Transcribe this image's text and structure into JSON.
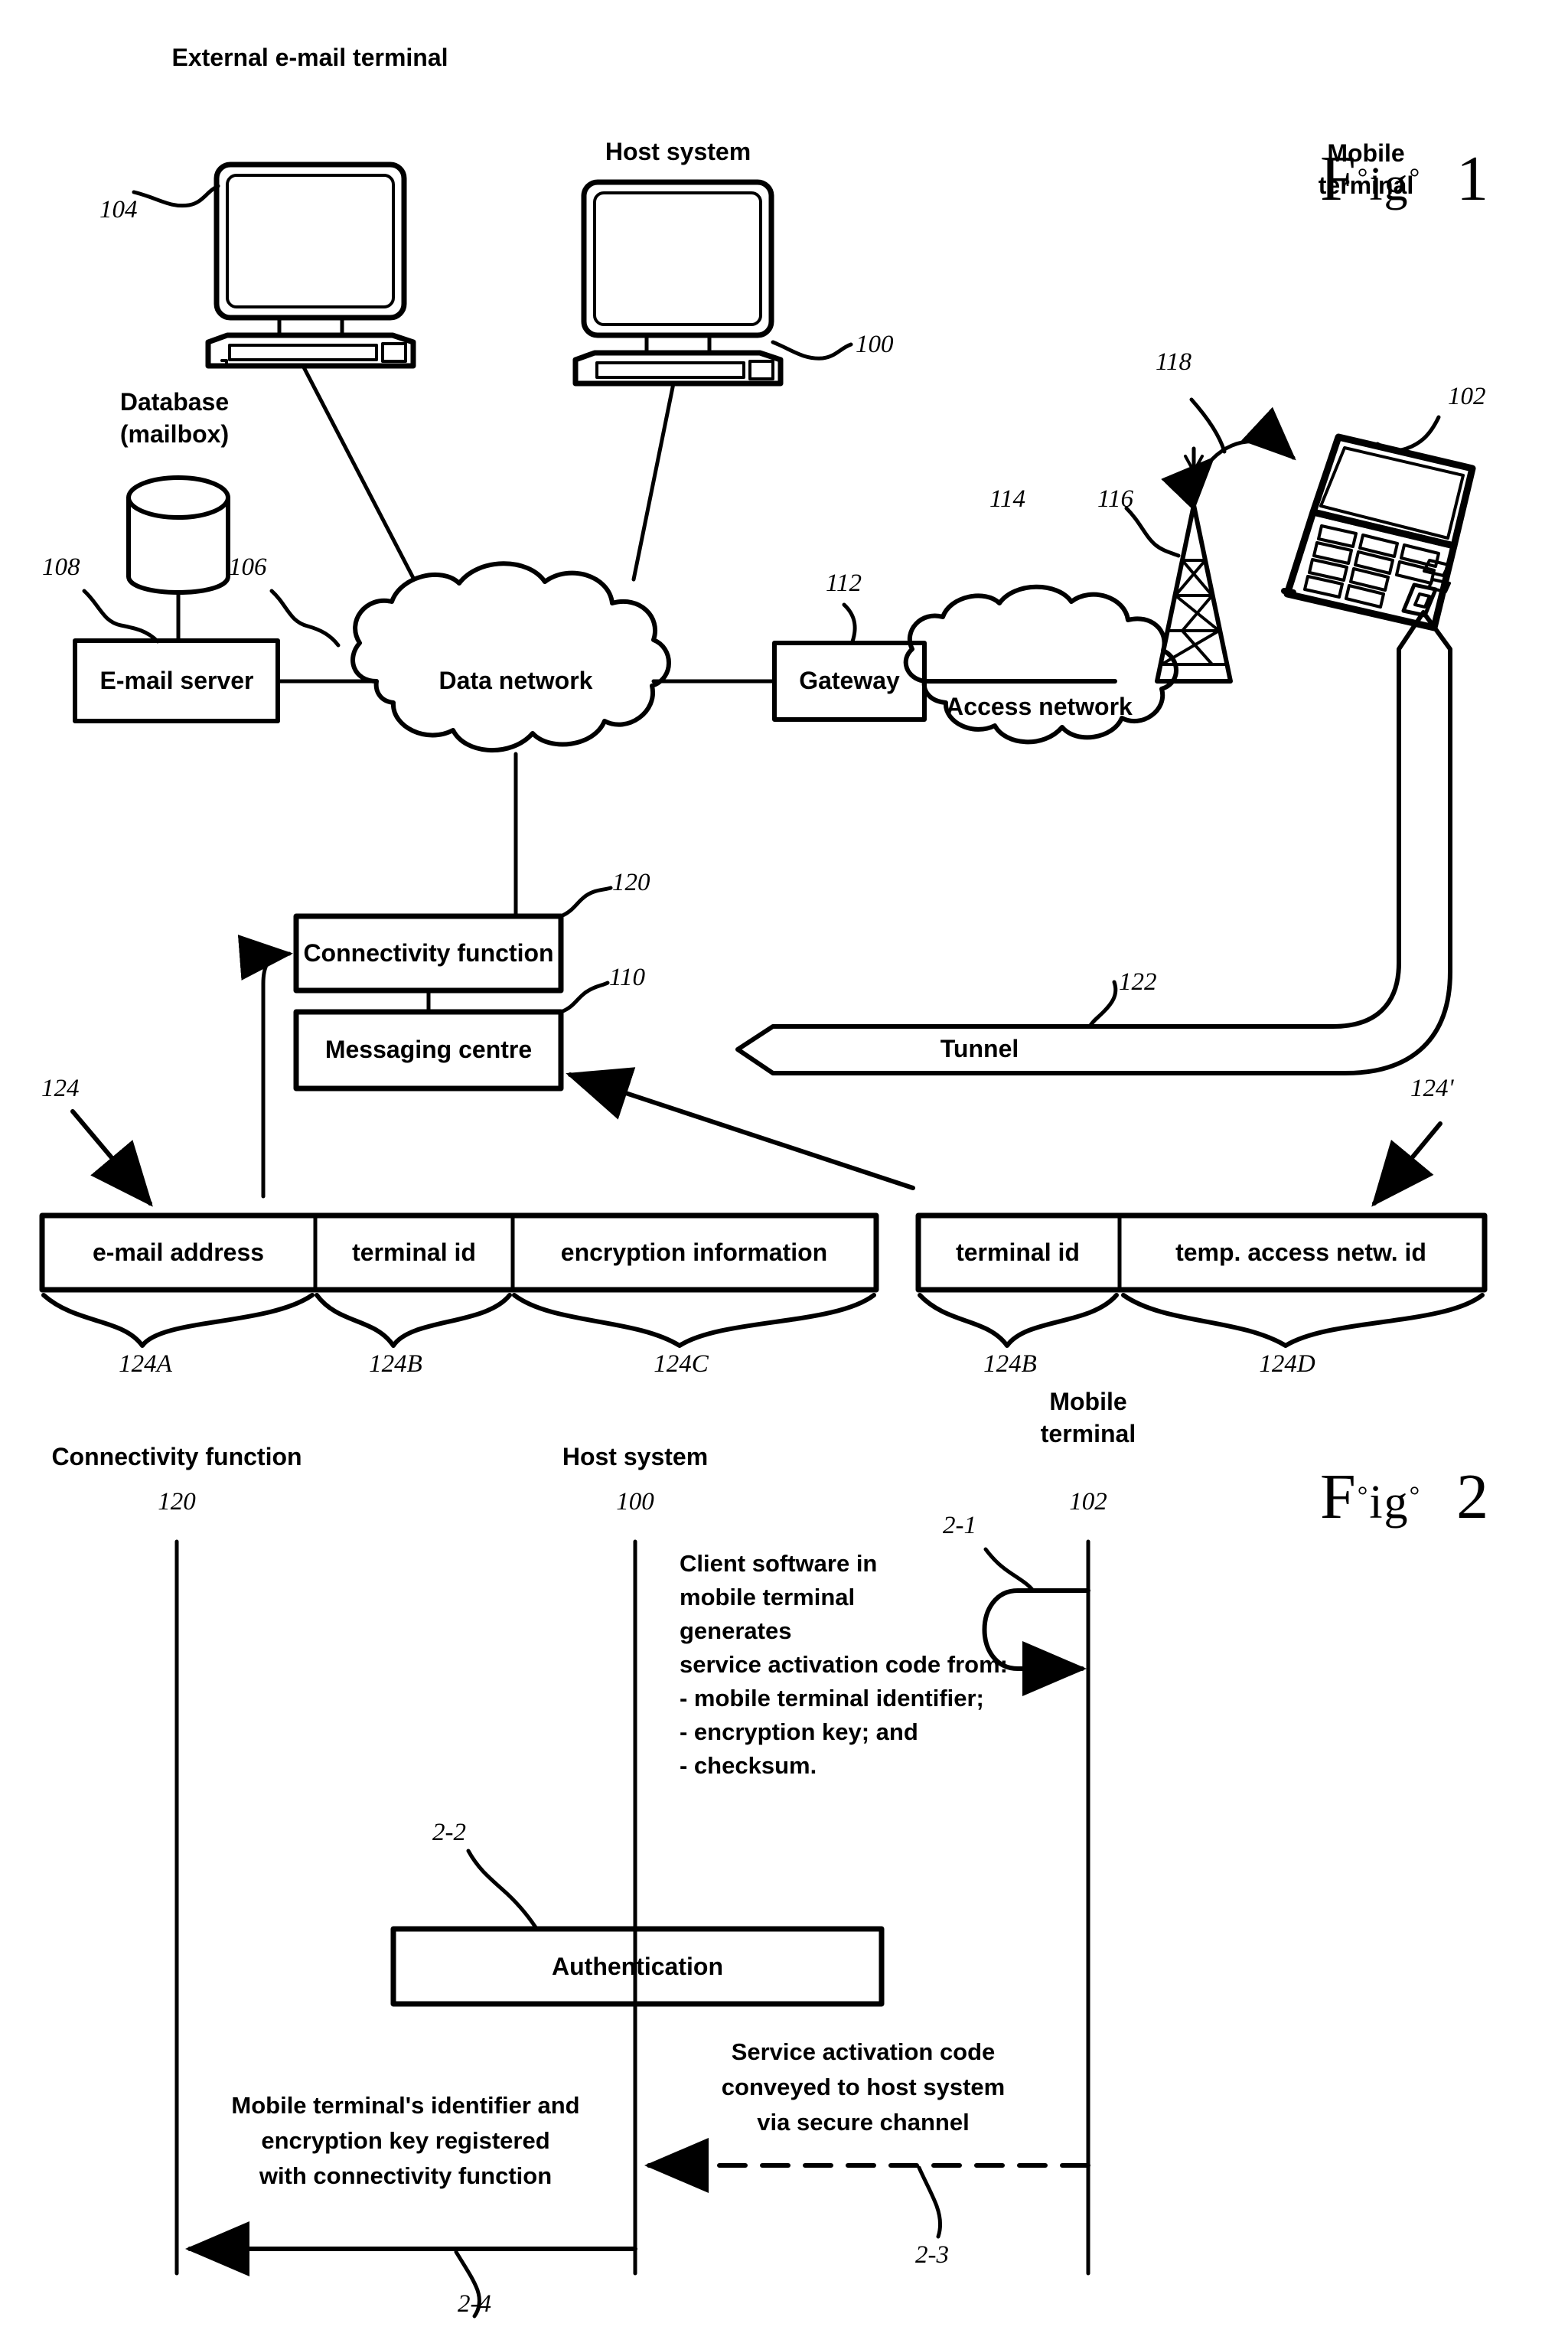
{
  "figures": [
    {
      "id": "fig1",
      "title_prefix": "F",
      "title_mid": "ig",
      "title_deg": "°",
      "title_number": "1",
      "labels": {
        "external_terminal": "External e-mail terminal",
        "host_system": "Host system",
        "mobile_terminal_line1": "Mobile",
        "mobile_terminal_line2": "terminal",
        "database_line1": "Database",
        "database_line2": "(mailbox)",
        "email_server": "E-mail server",
        "data_network": "Data network",
        "gateway": "Gateway",
        "access_network": "Access network",
        "connectivity_function": "Connectivity function",
        "messaging_centre": "Messaging centre",
        "tunnel": "Tunnel"
      },
      "reference_numerals": {
        "external_terminal": "104",
        "host_system": "100",
        "mobile_terminal": "102",
        "database": "108",
        "data_network": "106",
        "gateway": "112",
        "access_network": "114",
        "base_station": "116",
        "radio_link": "118",
        "connectivity_function": "120",
        "messaging_centre": "110",
        "tunnel": "122",
        "record_left": "124",
        "record_right": "124'"
      },
      "record_left": {
        "fields": [
          {
            "label": "e-mail address",
            "numeral": "124A"
          },
          {
            "label": "terminal id",
            "numeral": "124B"
          },
          {
            "label": "encryption information",
            "numeral": "124C"
          }
        ]
      },
      "record_right": {
        "fields": [
          {
            "label": "terminal id",
            "numeral": "124B"
          },
          {
            "label": "temp. access netw. id",
            "numeral": "124D"
          }
        ]
      }
    },
    {
      "id": "fig2",
      "title_prefix": "F",
      "title_mid": "ig",
      "title_deg": "°",
      "title_number": "2",
      "lifelines": [
        {
          "label": "Connectivity function",
          "numeral": "120"
        },
        {
          "label": "Host system",
          "numeral": "100"
        },
        {
          "label_line1": "Mobile",
          "label_line2": "terminal",
          "numeral": "102"
        }
      ],
      "steps": [
        {
          "numeral": "2-1",
          "text_lines": [
            "Client software in",
            "mobile terminal",
            "generates",
            "service activation code from:",
            "- mobile terminal identifier;",
            "- encryption key; and",
            "- checksum."
          ]
        },
        {
          "numeral": "2-2",
          "box_label": "Authentication"
        },
        {
          "numeral": "2-3",
          "text_lines": [
            "Service activation code",
            "conveyed to host system",
            "via secure channel"
          ]
        },
        {
          "numeral": "2-4",
          "text_lines": [
            "Mobile terminal's identifier and",
            "encryption key registered",
            "with connectivity function"
          ]
        }
      ]
    }
  ],
  "colors": {
    "ink": "#000000",
    "paper": "#ffffff"
  }
}
